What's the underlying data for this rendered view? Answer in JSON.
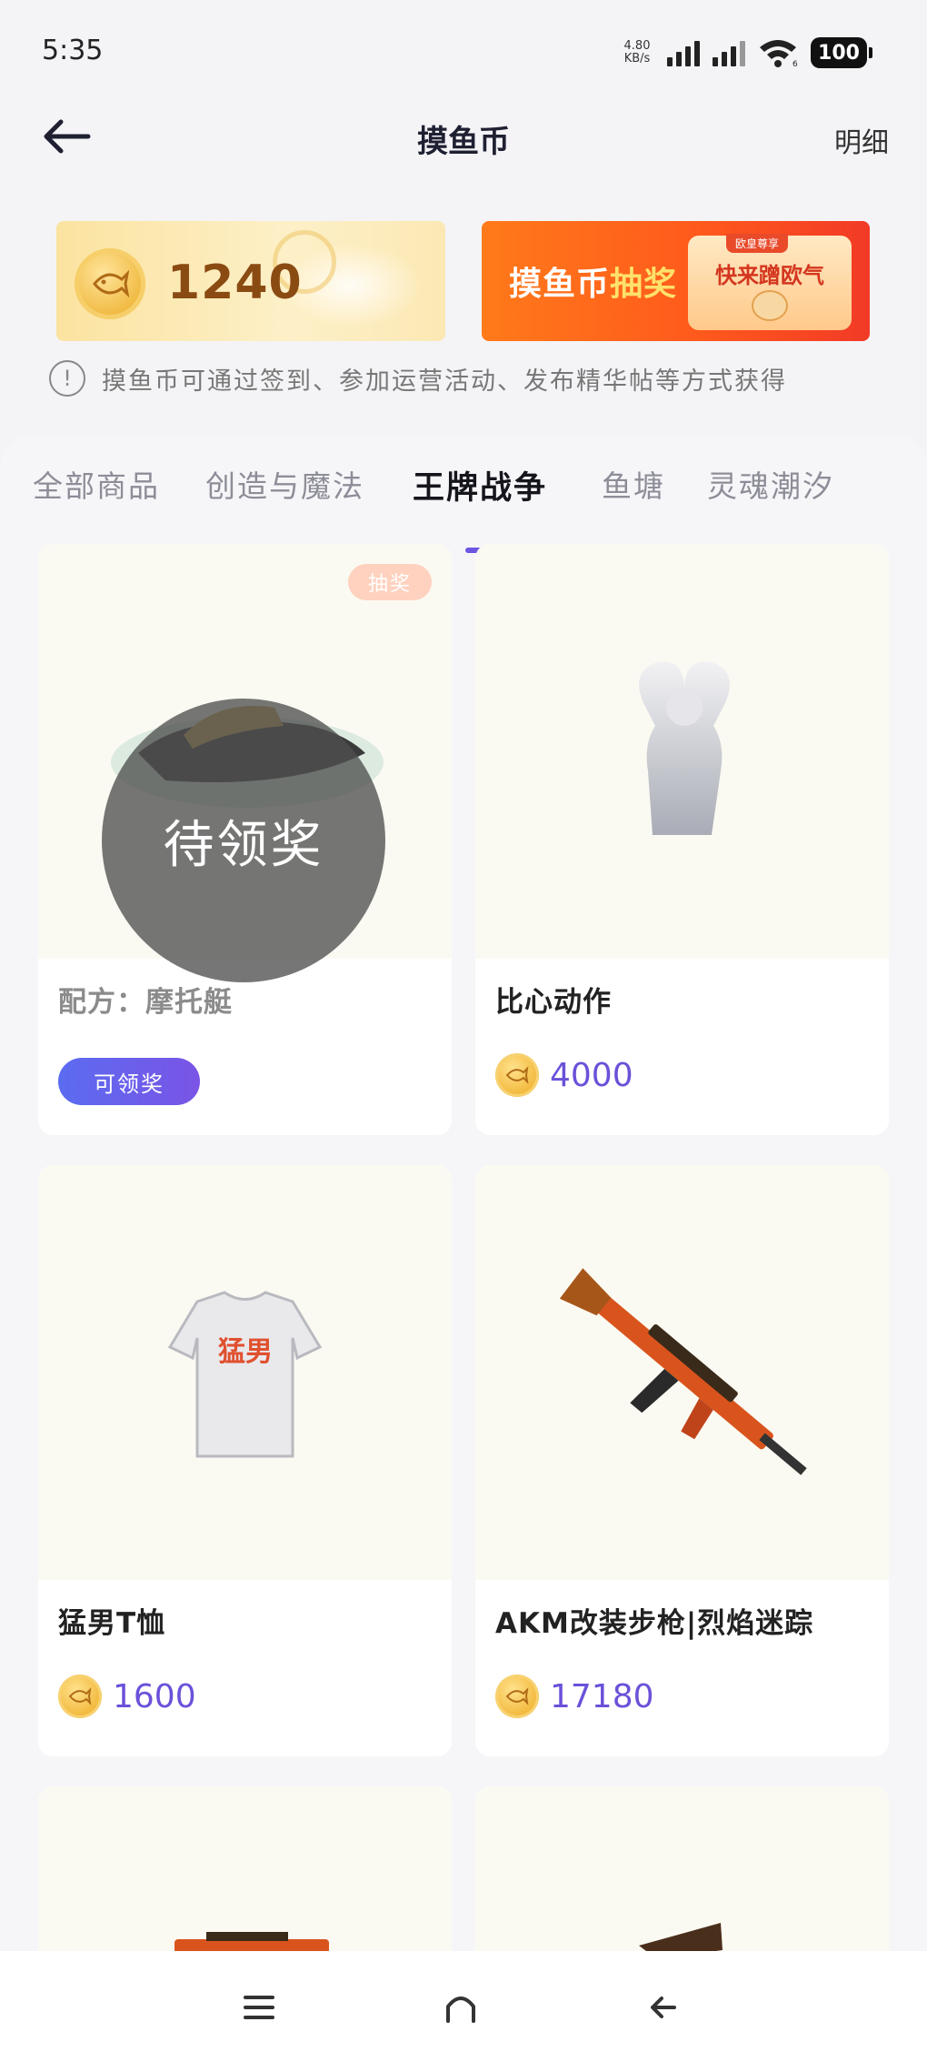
{
  "status_bar": {
    "time": "5:35",
    "net_speed_value": "4.80",
    "net_speed_unit": "KB/s",
    "wifi_badge": "6",
    "battery": "100"
  },
  "header": {
    "title": "摸鱼币",
    "detail_link": "明细",
    "back_icon": "arrow-left-icon"
  },
  "banners": {
    "coin_balance": "1240",
    "lottery_title_part1": "摸鱼币",
    "lottery_title_part2": "抽奖",
    "lottery_card_text": "快来蹭欧气",
    "lottery_card_tag": "欧皇尊享"
  },
  "info": {
    "text": "摸鱼币可通过签到、参加运营活动、发布精华帖等方式获得"
  },
  "tabs": [
    {
      "label": "全部商品",
      "active": false
    },
    {
      "label": "创造与魔法",
      "active": false
    },
    {
      "label": "王牌战争",
      "active": true
    },
    {
      "label": "鱼塘",
      "active": false
    },
    {
      "label": "灵魂潮汐",
      "active": false
    }
  ],
  "products": [
    {
      "name": "配方：摩托艇",
      "badge": "抽奖",
      "overlay": "待领奖",
      "action": "可领奖"
    },
    {
      "name": "比心动作",
      "price": "4000"
    },
    {
      "name": "猛男T恤",
      "price": "1600",
      "shirt_text": "猛男"
    },
    {
      "name": "AKM改装步枪|烈焰迷踪",
      "price": "17180"
    }
  ],
  "colors": {
    "accent": "#6c55e0",
    "price": "#6b51d9",
    "background": "#f4f4f7"
  }
}
